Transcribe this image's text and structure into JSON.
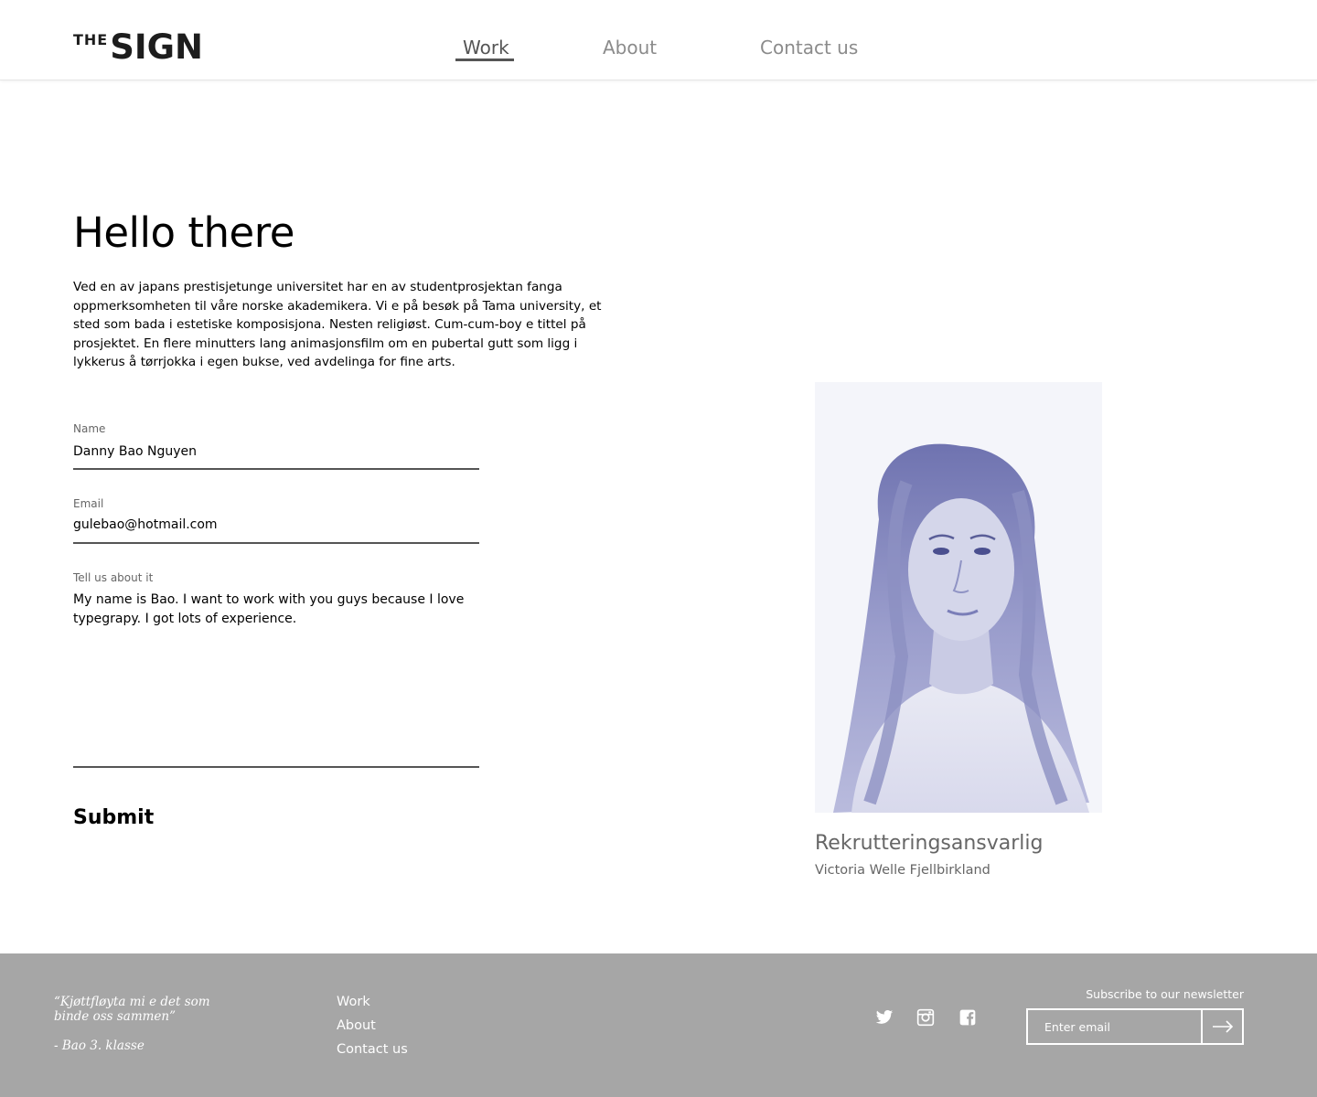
{
  "header": {
    "logo_top": "THE",
    "logo_main": "SIGN",
    "nav": [
      {
        "label": "Work",
        "active": true
      },
      {
        "label": "About"
      },
      {
        "label": "Contact us"
      }
    ]
  },
  "main": {
    "title": "Hello there",
    "intro": "Ved en av japans prestisjetunge universitet har en av studentprosjektan fanga oppmerksomheten til våre norske akademikera. Vi e på besøk på Tama university, et sted som bada i estetiske komposisjona. Nesten religiøst.  Cum-cum-boy e tittel på prosjektet. En flere minutters lang animasjonsfilm om en pubertal gutt som ligg i lykkerus å tørrjokka i egen bukse, ved avdelinga for fine arts.",
    "form": {
      "name_label": "Name",
      "name_value": "Danny Bao Nguyen",
      "email_label": "Email",
      "email_value": "gulebao@hotmail.com",
      "message_label": "Tell us about it",
      "message_value": "My name is Bao. I want to work with you guys because I love typegrapy. I got lots of experience.",
      "submit_label": "Submit"
    },
    "contact_person": {
      "role": "Rekrutteringsansvarlig",
      "name": "Victoria Welle Fjellbirkland"
    }
  },
  "footer": {
    "quote": "“Kjøttfløyta mi e det som binde oss sammen”",
    "quote_author": "- Bao 3. klasse",
    "links": [
      "Work",
      "About",
      "Contact us"
    ],
    "social_icons": [
      "twitter-icon",
      "instagram-icon",
      "facebook-icon"
    ],
    "newsletter_label": "Subscribe to our newsletter",
    "newsletter_placeholder": "Enter email"
  },
  "colors": {
    "footer_bg": "#a6a6a6",
    "nav_active": "#555555",
    "nav_inactive": "#8b8b8b",
    "portrait_tint": "#3a3f8f"
  }
}
